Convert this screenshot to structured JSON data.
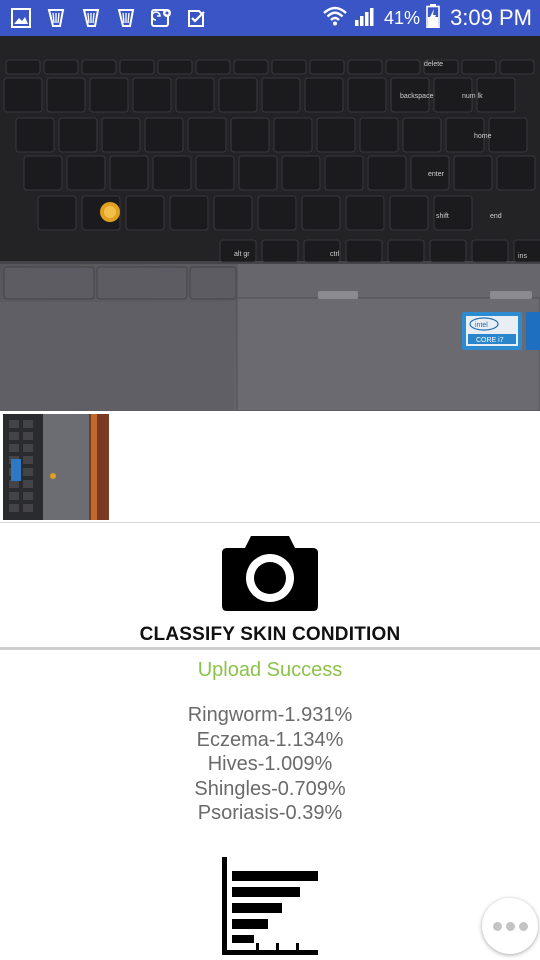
{
  "status_bar": {
    "battery_percent": "41%",
    "time": "3:09 PM",
    "notification_icons": [
      "image-icon",
      "harp-icon",
      "harp-icon",
      "harp-icon",
      "maps-icon",
      "check-icon"
    ],
    "status_icons": [
      "wifi-icon",
      "signal-icon",
      "battery-charging-icon"
    ]
  },
  "main_image": {
    "keyboard_keys": {
      "backspace": "backspace",
      "num_lk": "num lk",
      "home": "home",
      "enter": "enter",
      "shift": "shift",
      "end": "end",
      "alt_gr": "alt gr",
      "ctrl": "ctrl",
      "ins": "ins",
      "delete": "delete",
      "sticker_brand": "intel",
      "sticker_model": "CORE i7"
    }
  },
  "classify": {
    "label": "CLASSIFY SKIN CONDITION",
    "icon": "camera-icon"
  },
  "upload_status": "Upload Success",
  "results": [
    "Ringworm-1.931%",
    "Eczema-1.134%",
    "Hives-1.009%",
    "Shingles-0.709%",
    "Psoriasis-0.39%"
  ],
  "chart_button": {
    "icon": "bar-chart-icon"
  },
  "more_button": {
    "icon": "more-dots-icon"
  },
  "colors": {
    "status_bar": "#3a56c6",
    "success": "#8bc34a",
    "result_text": "#6a6a6a"
  }
}
